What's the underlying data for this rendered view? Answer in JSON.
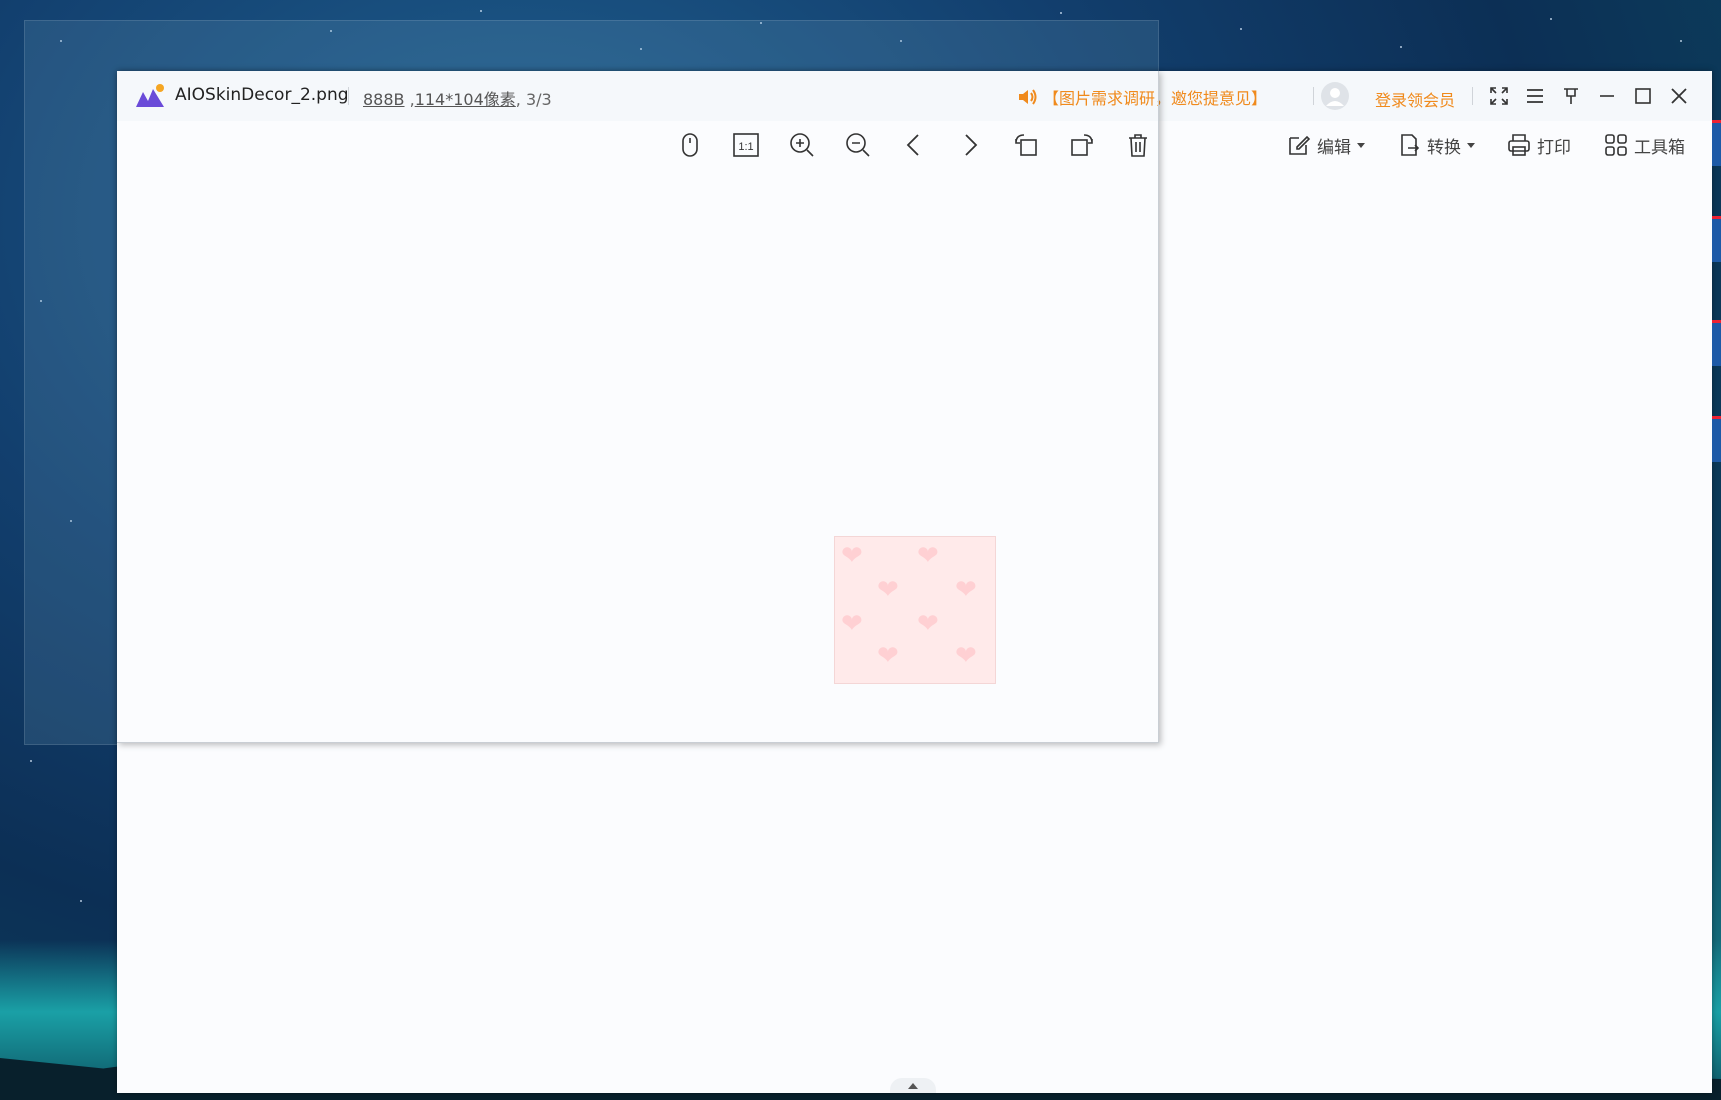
{
  "file": {
    "name": "AIOSkinDecor_2.png",
    "size": "888B",
    "dimensions": "114*104像素",
    "position": ", 3/3",
    "size_sep": " ,"
  },
  "notice": {
    "text": "【图片需求调研，邀您提意见】"
  },
  "account": {
    "login_label": "登录领会员"
  },
  "toolbar": {
    "icons": [
      "mouse-mode-icon",
      "actual-size-icon",
      "zoom-in-icon",
      "zoom-out-icon",
      "prev-icon",
      "next-icon",
      "rotate-left-icon",
      "rotate-right-icon",
      "delete-icon"
    ],
    "actual_size_label": "1:1",
    "menus": {
      "edit": "编辑",
      "convert": "转换",
      "print": "打印",
      "toolbox": "工具箱"
    }
  },
  "colors": {
    "accent": "#f08a1c",
    "thumb_bg": "#ffeaea",
    "heart": "#ffd0d3"
  }
}
